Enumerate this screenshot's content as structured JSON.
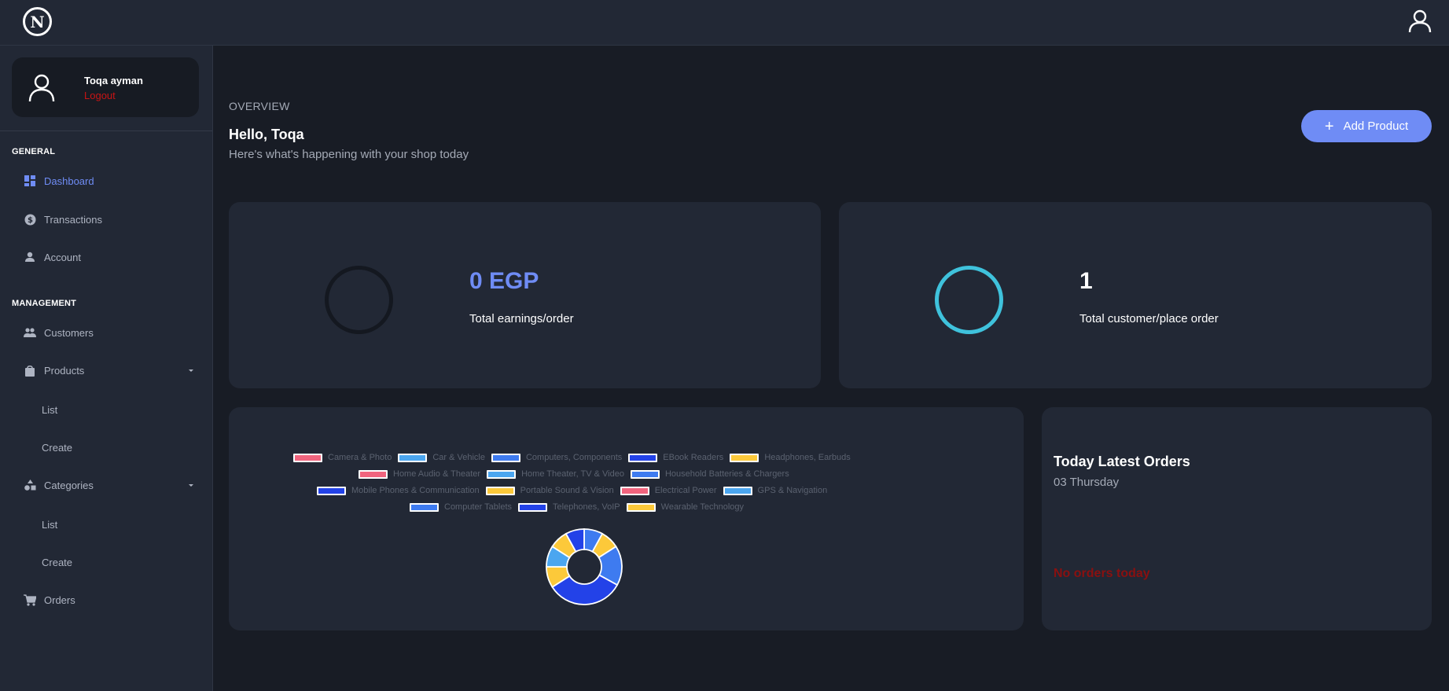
{
  "header": {
    "logo_text": "N"
  },
  "sidebar": {
    "user": {
      "name": "Toqa ayman",
      "logout_label": "Logout"
    },
    "general_title": "GENERAL",
    "general_items": [
      {
        "label": "Dashboard",
        "icon": "dashboard-icon",
        "active": true
      },
      {
        "label": "Transactions",
        "icon": "currency-icon"
      },
      {
        "label": "Account",
        "icon": "person-icon"
      }
    ],
    "management_title": "MANAGEMENT",
    "management_items": [
      {
        "label": "Customers",
        "icon": "people-icon"
      },
      {
        "label": "Products",
        "icon": "shopping-bag-icon",
        "sub": [
          "List",
          "Create"
        ]
      },
      {
        "label": "Categories",
        "icon": "categories-icon",
        "sub": [
          "List",
          "Create"
        ]
      },
      {
        "label": "Orders",
        "icon": "cart-icon"
      }
    ]
  },
  "overview": {
    "label": "OVERVIEW",
    "greeting": "Hello, Toqa",
    "subtitle": "Here's what's happening with your shop today",
    "add_product_label": "Add Product"
  },
  "stats": [
    {
      "value": "0 EGP",
      "label": "Total earnings/order",
      "color": "#6f8cf5",
      "ring_color": "#141820"
    },
    {
      "value": "1",
      "label": "Total customer/place order",
      "color": "#ffffff",
      "ring_color": "#3fc2dc"
    }
  ],
  "colors": {
    "pink": "#f1647e",
    "lightblue": "#4ba6f0",
    "blue": "#3e7bf0",
    "darkblue": "#2342e8",
    "yellow": "#fcc93a",
    "accent": "#6f8cf5"
  },
  "chart_data": {
    "type": "pie",
    "donut": true,
    "legend": [
      {
        "name": "Camera & Photo",
        "color": "#f1647e"
      },
      {
        "name": "Car & Vehicle",
        "color": "#4ba6f0"
      },
      {
        "name": "Computers, Components",
        "color": "#3e7bf0"
      },
      {
        "name": "EBook Readers",
        "color": "#2342e8"
      },
      {
        "name": "Headphones, Earbuds",
        "color": "#fcc93a"
      },
      {
        "name": "Home Audio & Theater",
        "color": "#f1647e"
      },
      {
        "name": "Home Theater, TV & Video",
        "color": "#4ba6f0"
      },
      {
        "name": "Household Batteries & Chargers",
        "color": "#3e7bf0"
      },
      {
        "name": "Mobile Phones & Communication",
        "color": "#2342e8"
      },
      {
        "name": "Portable Sound & Vision",
        "color": "#fcc93a"
      },
      {
        "name": "Electrical Power",
        "color": "#f1647e"
      },
      {
        "name": "GPS & Navigation",
        "color": "#4ba6f0"
      },
      {
        "name": "Computer Tablets",
        "color": "#3e7bf0"
      },
      {
        "name": "Telephones, VoIP",
        "color": "#2342e8"
      },
      {
        "name": "Wearable Technology",
        "color": "#fcc93a"
      }
    ],
    "slices": [
      {
        "value": 8,
        "color": "#3e7bf0"
      },
      {
        "value": 8,
        "color": "#fcc93a"
      },
      {
        "value": 17,
        "color": "#3e7bf0"
      },
      {
        "value": 33,
        "color": "#2342e8"
      },
      {
        "value": 9,
        "color": "#fcc93a"
      },
      {
        "value": 9,
        "color": "#4ba6f0"
      },
      {
        "value": 8,
        "color": "#fcc93a"
      },
      {
        "value": 8,
        "color": "#2342e8"
      }
    ]
  },
  "orders": {
    "title": "Today Latest Orders",
    "date": "03 Thursday",
    "empty_text": "No orders today"
  }
}
